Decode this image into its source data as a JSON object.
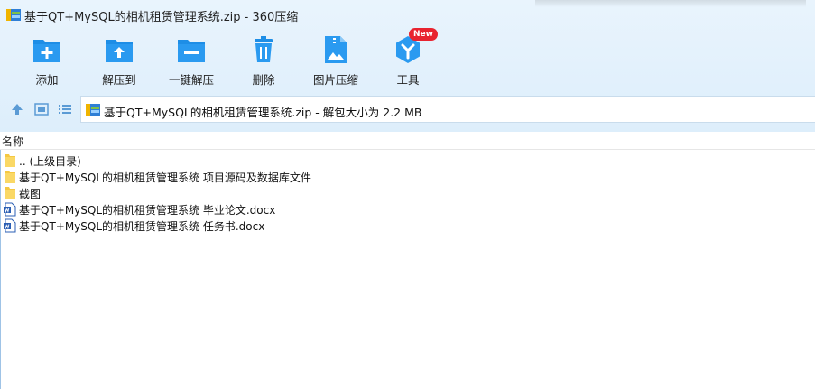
{
  "window": {
    "title": "基于QT+MySQL的相机租赁管理系统.zip - 360压缩"
  },
  "toolbar": {
    "items": [
      {
        "label": "添加",
        "icon": "add-folder-icon"
      },
      {
        "label": "解压到",
        "icon": "extract-to-icon"
      },
      {
        "label": "一键解压",
        "icon": "one-click-extract-icon"
      },
      {
        "label": "删除",
        "icon": "trash-icon"
      },
      {
        "label": "图片压缩",
        "icon": "image-compress-icon"
      },
      {
        "label": "工具",
        "icon": "tools-icon",
        "badge": "New"
      }
    ]
  },
  "navbar": {
    "path": "基于QT+MySQL的相机租赁管理系统.zip - 解包大小为 2.2 MB"
  },
  "list": {
    "column_name": "名称",
    "rows": [
      {
        "name": ".. (上级目录)",
        "type": "folder"
      },
      {
        "name": "基于QT+MySQL的相机租赁管理系统 项目源码及数据库文件",
        "type": "folder"
      },
      {
        "name": "截图",
        "type": "folder"
      },
      {
        "name": "基于QT+MySQL的相机租赁管理系统 毕业论文.docx",
        "type": "docx"
      },
      {
        "name": "基于QT+MySQL的相机租赁管理系统 任务书.docx",
        "type": "docx"
      }
    ]
  },
  "colors": {
    "accent": "#1e8ee6",
    "badge": "#e8232f",
    "folder": "#f5c842"
  }
}
